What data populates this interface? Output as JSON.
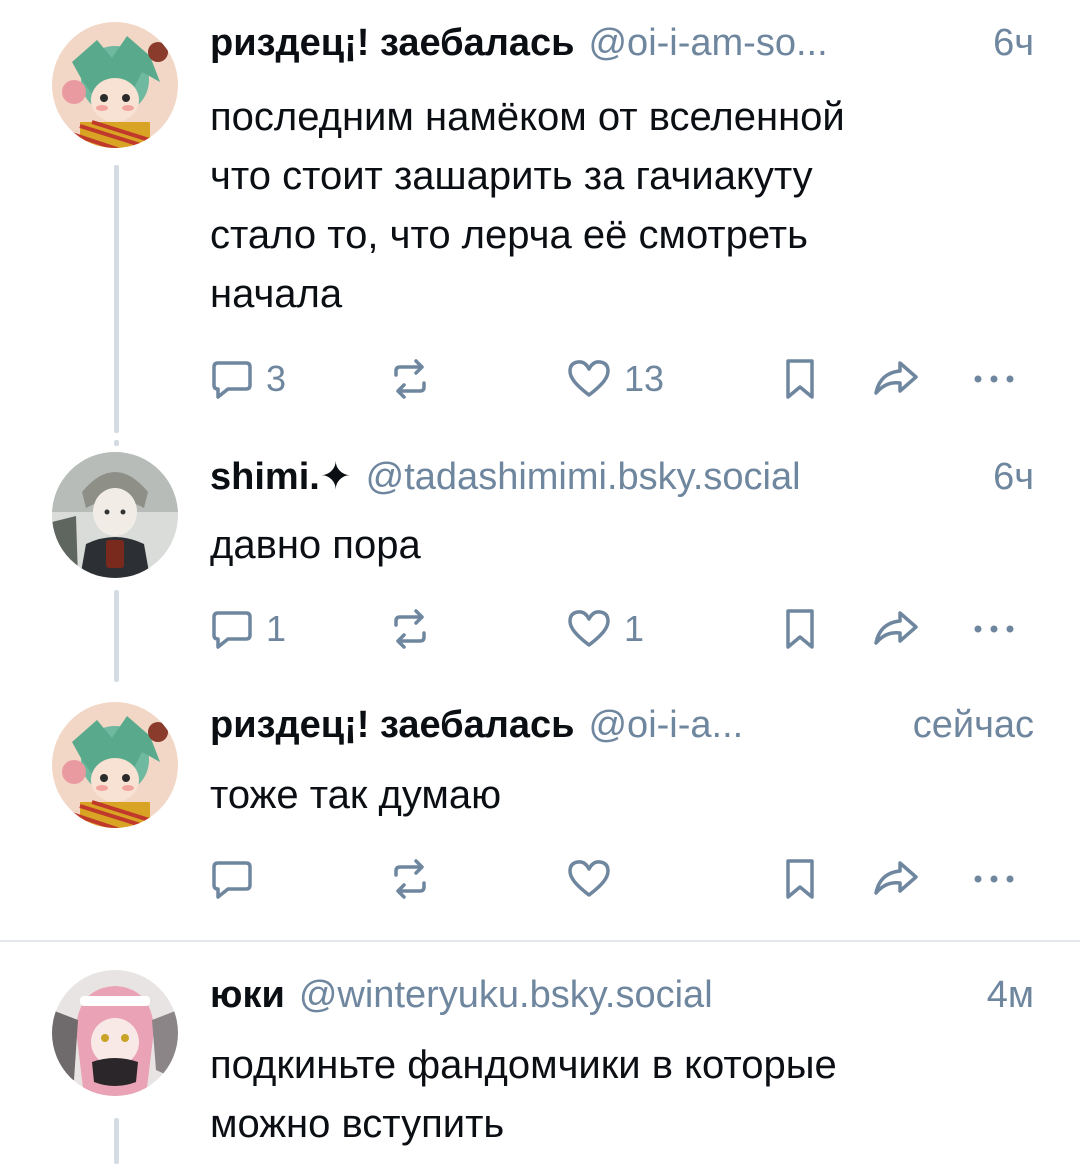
{
  "posts": [
    {
      "author": "риздец¡! заебалась",
      "handle": "@oi-i-am-so...",
      "time": "6ч",
      "text": "последним намёком от вселенной\nчто стоит зашарить за гачиакуту\nстало то, что лерча её смотреть\nначала",
      "replies": "3",
      "reposts": "",
      "likes": "13"
    },
    {
      "author": "shimi.✦",
      "handle": "@tadashimimi.bsky.social",
      "time": "6ч",
      "text": "давно пора",
      "replies": "1",
      "reposts": "",
      "likes": "1"
    },
    {
      "author": "риздец¡! заебалась",
      "handle": "@oi-i-a...",
      "time": "сейчас",
      "text": "тоже так думаю",
      "replies": "",
      "reposts": "",
      "likes": ""
    },
    {
      "author": "юки",
      "handle": "@winteryuku.bsky.social",
      "time": "4м",
      "text": "подкиньте фандомчики в которые\nможно вступить"
    }
  ],
  "icons": {
    "reply": "reply-bubble-icon",
    "repost": "repost-arrows-icon",
    "like": "heart-icon",
    "bookmark": "bookmark-icon",
    "share": "share-arrow-icon",
    "more": "ellipsis-icon"
  },
  "colors": {
    "text": "#0b0f14",
    "muted": "#6f869f",
    "thread_line": "#d4dbe2",
    "divider": "#e4e8ec"
  }
}
